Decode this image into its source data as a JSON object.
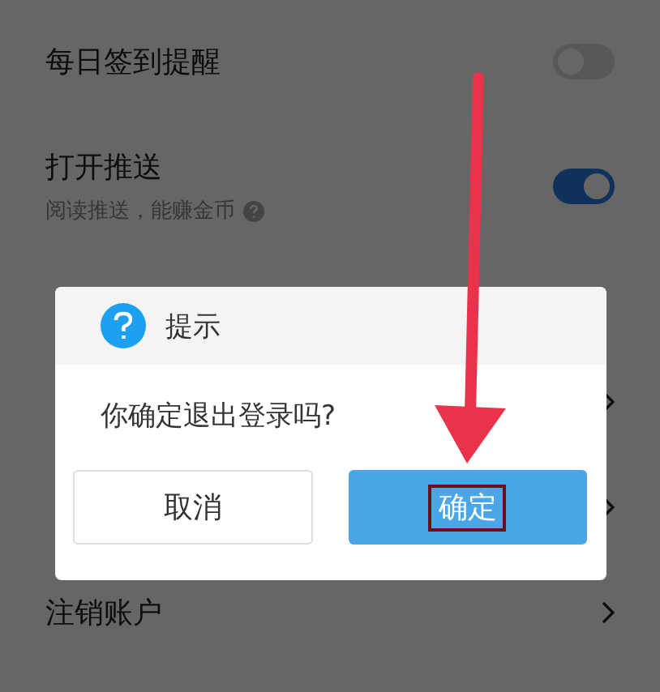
{
  "settings": [
    {
      "kind": "toggle",
      "title": "每日签到提醒",
      "on": false
    },
    {
      "kind": "toggle",
      "title": "打开推送",
      "subtitle": "阅读推送，能赚金币",
      "help": true,
      "on": true
    },
    {
      "kind": "plain"
    },
    {
      "kind": "link"
    },
    {
      "kind": "link"
    },
    {
      "kind": "link",
      "title": "注销账户"
    }
  ],
  "dialog": {
    "title": "提示",
    "message": "你确定退出登录吗?",
    "buttons": [
      {
        "label": "取消",
        "primary": false,
        "highlighted": false
      },
      {
        "label": "确定",
        "primary": true,
        "highlighted": true
      }
    ]
  },
  "annotations": [
    {
      "kind": "arrow"
    }
  ]
}
